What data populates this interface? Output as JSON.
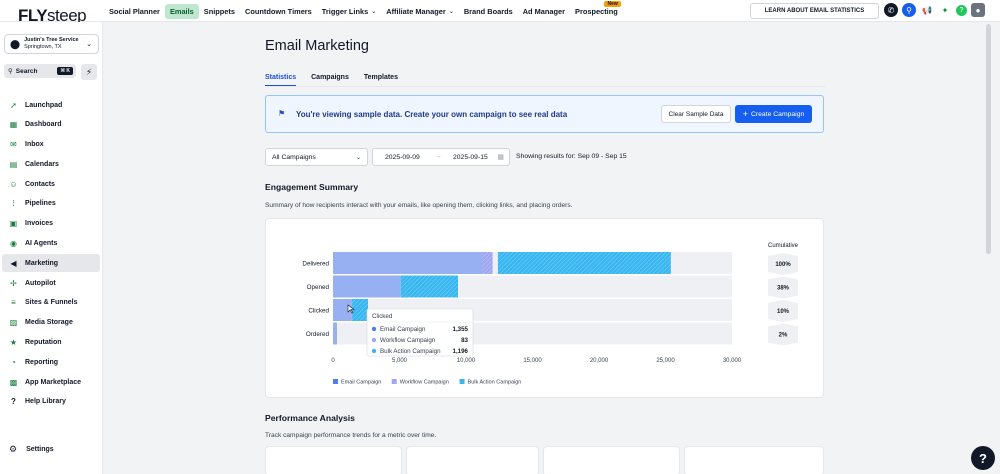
{
  "topbar": {
    "logo_bold": "FLY",
    "logo_light": "steep",
    "nav": [
      {
        "label": "Social Planner",
        "active": false,
        "chevron": false
      },
      {
        "label": "Emails",
        "active": true,
        "chevron": false
      },
      {
        "label": "Snippets",
        "active": false,
        "chevron": false
      },
      {
        "label": "Countdown Timers",
        "active": false,
        "chevron": false
      },
      {
        "label": "Trigger Links",
        "active": false,
        "chevron": true
      },
      {
        "label": "Affiliate Manager",
        "active": false,
        "chevron": true
      },
      {
        "label": "Brand Boards",
        "active": false,
        "chevron": false
      },
      {
        "label": "Ad Manager",
        "active": false,
        "chevron": false
      },
      {
        "label": "Prospecting",
        "active": false,
        "chevron": false,
        "badge": "New"
      }
    ],
    "learn_label": "LEARN ABOUT EMAIL STATISTICS"
  },
  "sidebar": {
    "location_name": "Justin's Tree Service",
    "location_city": "Springtown, TX",
    "search_label": "Search",
    "search_kbd": "⌘ K",
    "items": [
      {
        "label": "Launchpad",
        "icon": "rocket-icon",
        "active": false
      },
      {
        "label": "Dashboard",
        "icon": "dashboard-icon",
        "active": false
      },
      {
        "label": "Inbox",
        "icon": "inbox-icon",
        "active": false
      },
      {
        "label": "Calendars",
        "icon": "calendar-icon",
        "active": false
      },
      {
        "label": "Contacts",
        "icon": "contacts-icon",
        "active": false
      },
      {
        "label": "Pipelines",
        "icon": "pipeline-icon",
        "active": false
      },
      {
        "label": "Invoices",
        "icon": "invoice-icon",
        "active": false
      },
      {
        "label": "AI Agents",
        "icon": "ai-agent-icon",
        "active": false
      },
      {
        "label": "Marketing",
        "icon": "megaphone-icon",
        "active": true
      },
      {
        "label": "Autopilot",
        "icon": "autopilot-icon",
        "active": false
      },
      {
        "label": "Sites & Funnels",
        "icon": "sites-icon",
        "active": false
      },
      {
        "label": "Media Storage",
        "icon": "media-icon",
        "active": false
      },
      {
        "label": "Reputation",
        "icon": "star-icon",
        "active": false
      },
      {
        "label": "Reporting",
        "icon": "reporting-icon",
        "active": false
      },
      {
        "label": "App Marketplace",
        "icon": "marketplace-icon",
        "active": false
      },
      {
        "label": "Help Library",
        "icon": "help-icon",
        "active": false
      }
    ],
    "settings_label": "Settings"
  },
  "page": {
    "title": "Email Marketing",
    "tabs": [
      {
        "label": "Statistics",
        "active": true
      },
      {
        "label": "Campaigns",
        "active": false
      },
      {
        "label": "Templates",
        "active": false
      }
    ],
    "banner_text": "You're viewing sample data. Create your own campaign to see real data",
    "clear_label": "Clear Sample Data",
    "create_label": "Create Campaign",
    "campaign_select": "All Campaigns",
    "date_from": "2025-09-09",
    "date_to": "2025-09-15",
    "showing": "Showing results for: Sep 09 - Sep 15",
    "engagement_title": "Engagement Summary",
    "engagement_sub": "Summary of how recipients interact with your emails, like opening them, clicking links, and placing orders.",
    "performance_title": "Performance Analysis",
    "performance_sub": "Track campaign performance trends for a metric over time."
  },
  "chart_data": {
    "type": "bar",
    "stacked": true,
    "orientation": "horizontal",
    "categories": [
      "Delivered",
      "Opened",
      "Clicked",
      "Ordered"
    ],
    "series": [
      {
        "name": "Email Campaign",
        "color": "#4f7cf0",
        "values": [
          11200,
          5100,
          1355,
          300
        ]
      },
      {
        "name": "Workflow Campaign",
        "color": "#a1a6f0",
        "values": [
          800,
          0,
          83,
          0
        ]
      },
      {
        "name": "Bulk Action Campaign",
        "color": "#38b6f0",
        "values": [
          13000,
          4300,
          1196,
          0
        ]
      }
    ],
    "xlim": [
      0,
      30000
    ],
    "xticks": [
      0,
      5000,
      10000,
      15000,
      20000,
      25000,
      30000
    ],
    "xtick_labels": [
      "0",
      "5,000",
      "10,000",
      "15,000",
      "20,000",
      "25,000",
      "30,000"
    ],
    "cumulative_title": "Cumulative",
    "cumulative": [
      "100%",
      "38%",
      "10%",
      "2%"
    ],
    "legend_position": "bottom",
    "tooltip": {
      "title": "Clicked",
      "rows": [
        {
          "name": "Email Campaign",
          "value": "1,355",
          "color": "#4f7cf0"
        },
        {
          "name": "Workflow Campaign",
          "value": "83",
          "color": "#a1a6f0"
        },
        {
          "name": "Bulk Action Campaign",
          "value": "1,196",
          "color": "#38b6f0"
        }
      ]
    }
  }
}
